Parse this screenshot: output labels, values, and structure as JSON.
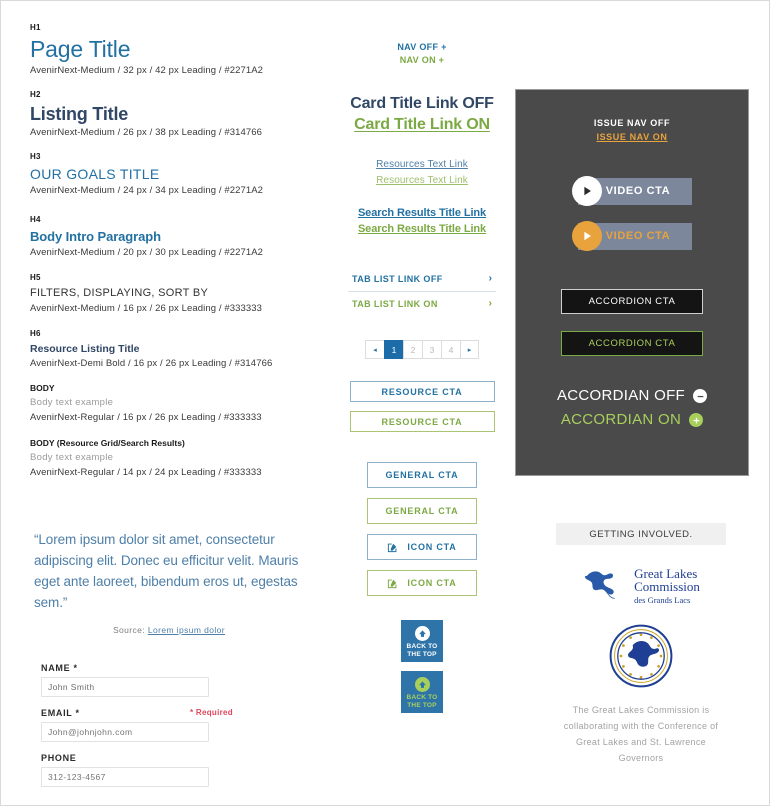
{
  "typography": {
    "items": [
      {
        "tag": "H1",
        "sample": "Page Title",
        "spec": "AvenirNext-Medium / 32 px / 42 px Leading / #2271A2"
      },
      {
        "tag": "H2",
        "sample": "Listing Title",
        "spec": "AvenirNext-Medium / 26 px / 38 px Leading / #314766"
      },
      {
        "tag": "H3",
        "sample": "OUR GOALS TITLE",
        "spec": "AvenirNext-Medium / 24 px / 34 px Leading / #2271A2"
      },
      {
        "tag": "H4",
        "sample": "Body Intro Paragraph",
        "spec": "AvenirNext-Medium / 20 px / 30 px Leading / #2271A2"
      },
      {
        "tag": "H5",
        "sample": "FILTERS, DISPLAYING, SORT BY",
        "spec": "AvenirNext-Medium / 16 px / 26 px Leading / #333333"
      },
      {
        "tag": "H6",
        "sample": "Resource Listing Title",
        "spec": "AvenirNext-Demi Bold / 16 px / 26 px Leading / #314766"
      }
    ],
    "body": [
      {
        "label": "BODY",
        "sample": "Body text example",
        "spec": "AvenirNext-Regular / 16 px / 26 px Leading / #333333"
      },
      {
        "label": "BODY (Resource Grid/Search Results)",
        "sample": "Body text example",
        "spec": "AvenirNext-Regular / 14 px / 24 px Leading / #333333"
      }
    ]
  },
  "quote": {
    "text": "“Lorem ipsum dolor sit amet, consectetur adipiscing elit. Donec eu efficitur velit. Mauris eget ante laoreet, bibendum eros ut, egestas sem.”",
    "source_prefix": "Source: ",
    "source_link": "Lorem ipsum dolor"
  },
  "form": {
    "required_note": "* Required",
    "fields": [
      {
        "label": "NAME *",
        "value": "John Smith",
        "placeholder": "John Smith",
        "filled": true
      },
      {
        "label": "EMAIL *",
        "value": "",
        "placeholder": "John@johnjohn.com",
        "filled": false
      },
      {
        "label": "PHONE",
        "value": "",
        "placeholder": "312-123-4567",
        "filled": false
      }
    ]
  },
  "middle": {
    "nav_off": "NAV OFF +",
    "nav_on": "NAV ON +",
    "card_title_off": "Card Title Link OFF",
    "card_title_on": "Card Title Link ON",
    "resource_link_off": "Resources Text Link",
    "resource_link_on": "Resources Text Link",
    "search_result_off": "Search Results Title Link",
    "search_result_on": "Search Results Title Link",
    "tab_off": "TAB LIST LINK OFF",
    "tab_on": "TAB LIST LINK ON",
    "chevron": "›",
    "pagination": {
      "prev": "◂",
      "next": "▸",
      "pages": [
        "1",
        "2",
        "3",
        "4"
      ],
      "active": "1"
    },
    "resource_cta_off": "RESOURCE CTA",
    "resource_cta_on": "RESOURCE CTA",
    "general_cta_off": "GENERAL CTA",
    "general_cta_on": "GENERAL CTA",
    "icon_cta_off": "ICON CTA",
    "icon_cta_on": "ICON CTA",
    "back_to_top_line1": "BACK TO",
    "back_to_top_line2": "THE TOP"
  },
  "dark_panel": {
    "issue_nav_off": "ISSUE NAV OFF",
    "issue_nav_on": "ISSUE NAV ON",
    "video_cta_off": "VIDEO CTA",
    "video_cta_on": "VIDEO CTA",
    "accordion_cta_off": "ACCORDION CTA",
    "accordion_cta_on": "ACCORDION CTA",
    "accordian_off": "ACCORDIAN OFF",
    "accordian_on": "ACCORDIAN ON",
    "minus": "–",
    "plus": "+"
  },
  "involved": {
    "heading": "GETTING INVOLVED.",
    "logo_line1": "Great Lakes",
    "logo_line2": "Commission",
    "logo_line3": "des Grands Lacs",
    "note": "The Great Lakes Commission is collaborating with the Conference of Great Lakes and St. Lawrence Governors"
  },
  "colors": {
    "blue_primary": "#2271A2",
    "blue_dark": "#314766",
    "green": "#7BA943",
    "green_light": "#A8CF5C",
    "orange": "#E8A33D",
    "red": "#e0455c",
    "grey_body": "#333333",
    "panel_dark": "#4a4a4a"
  }
}
